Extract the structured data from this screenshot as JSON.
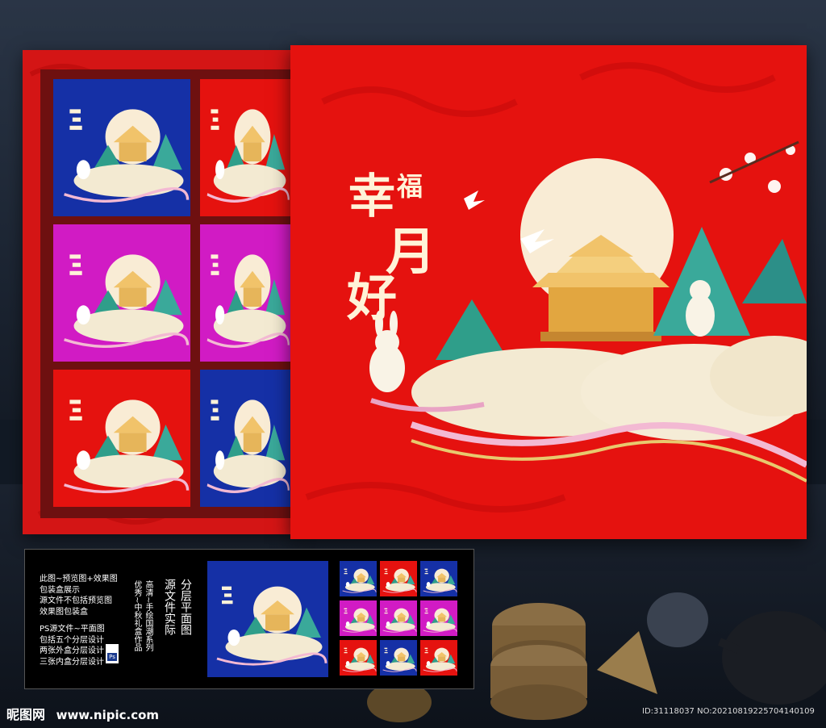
{
  "colors": {
    "red": "#e5120f",
    "blue": "#1530a6",
    "magenta": "#d11bc4",
    "moon": "#f9ecd5",
    "gold": "#e6b55a"
  },
  "box_title": {
    "main_1": "幸",
    "side": "福",
    "main_2": "月",
    "main_3": "好"
  },
  "info_panel": {
    "lines_a": [
      "此图~预览图+效果图",
      "包装盒展示",
      "源文件不包括预览图",
      "效果图包装盒"
    ],
    "lines_b": [
      "PS源文件~平面图",
      "包括五个分层设计",
      "两张外盒分层设计",
      "三张内盒分层设计"
    ],
    "ps_badge": "Ps",
    "vertical_cols": [
      "优秀~中秋礼盒作品",
      "高清~手绘国潮系列",
      "源文件实际",
      "分层平面图"
    ]
  },
  "tray_colors": [
    "blue",
    "red",
    "magenta",
    "magenta",
    "red",
    "blue"
  ],
  "thumb_colors": [
    "blue",
    "red",
    "blue",
    "magenta",
    "magenta",
    "magenta",
    "red",
    "blue",
    "red"
  ],
  "watermark": {
    "logo": "昵图网",
    "url": "www.nipic.com",
    "id_text": "ID:31118037 NO:20210819225704140109"
  }
}
